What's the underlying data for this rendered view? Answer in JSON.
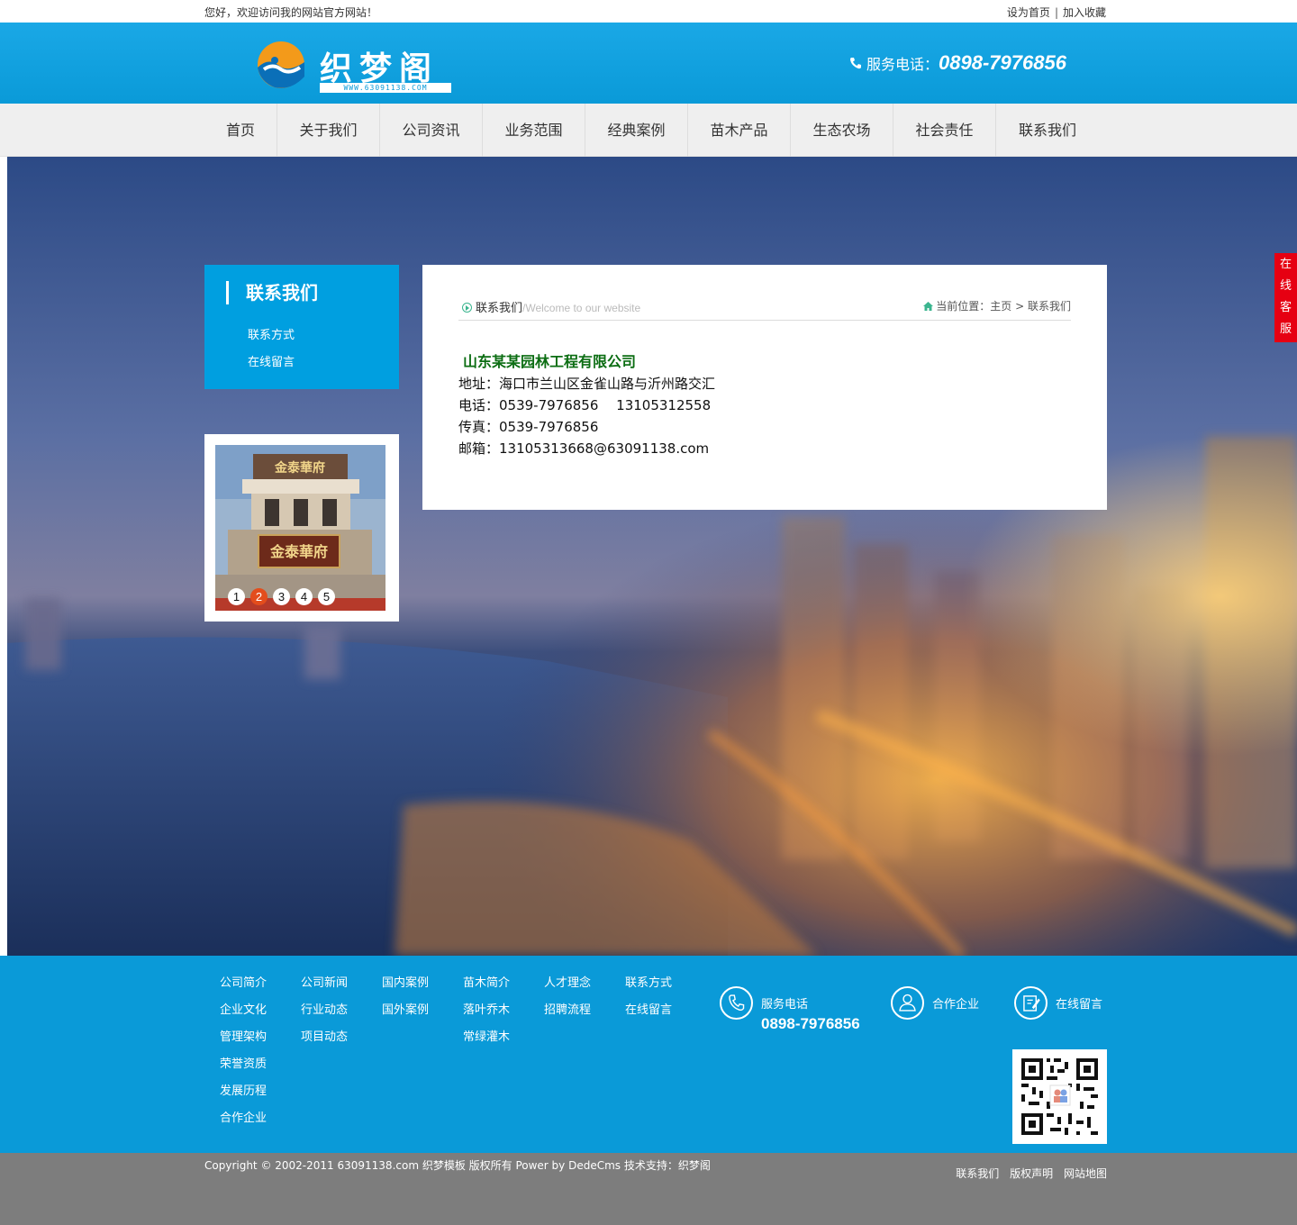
{
  "topbar": {
    "welcome": "您好，欢迎访问我的网站官方网站！",
    "set_home": "设为首页",
    "separator": "|",
    "bookmark": "加入收藏"
  },
  "header": {
    "logo_text": "织梦阁",
    "logo_url": "WWW.63091138.COM",
    "hotline_label": "服务电话：",
    "hotline_number": "0898-7976856"
  },
  "nav": {
    "items": [
      "首页",
      "关于我们",
      "公司资讯",
      "业务范围",
      "经典案例",
      "苗木产品",
      "生态农场",
      "社会责任",
      "联系我们"
    ]
  },
  "sidebar": {
    "title": "联系我们",
    "items": [
      "联系方式",
      "在线留言"
    ],
    "slider_pages": [
      "1",
      "2",
      "3",
      "4",
      "5"
    ],
    "slider_active": 2,
    "photo_sign_top": "金泰華府",
    "photo_sign_main": "金泰華府"
  },
  "content": {
    "title": "联系我们",
    "subtitle": "/Welcome to our website",
    "location_label": "当前位置：",
    "crumb_home": "主页",
    "crumb_sep": ">",
    "crumb_current": "联系我们",
    "company": "山东某某园林工程有限公司",
    "address": "地址：海口市兰山区金雀山路与沂州路交汇",
    "phone": "电话：0539-7976856　 13105312558",
    "fax": "传真：0539-7976856",
    "email": "邮箱：13105313668@63091138.com"
  },
  "online_service": [
    "在",
    "线",
    "客",
    "服"
  ],
  "footer": {
    "columns": [
      [
        "公司简介",
        "企业文化",
        "管理架构",
        "荣誉资质",
        "发展历程",
        "合作企业"
      ],
      [
        "公司新闻",
        "行业动态",
        "项目动态"
      ],
      [
        "国内案例",
        "国外案例"
      ],
      [
        "苗木简介",
        "落叶乔木",
        "常绿灌木"
      ],
      [
        "人才理念",
        "招聘流程"
      ],
      [
        "联系方式",
        "在线留言"
      ]
    ],
    "service_label": "服务电话",
    "service_number": "0898-7976856",
    "partner_label": "合作企业",
    "message_label": "在线留言"
  },
  "copyright": {
    "text": "Copyright © 2002-2011 63091138.com 织梦模板 版权所有 Power by DedeCms 技术支持：织梦阁",
    "links": [
      "联系我们",
      "版权声明",
      "网站地图"
    ]
  },
  "colors": {
    "brand_blue": "#0a9ad8",
    "nav_bg": "#efefef",
    "online_red": "#e60012",
    "company_green": "#0b6d12",
    "slider_active": "#e34d1c",
    "footer_gray": "#7d7d7d"
  }
}
